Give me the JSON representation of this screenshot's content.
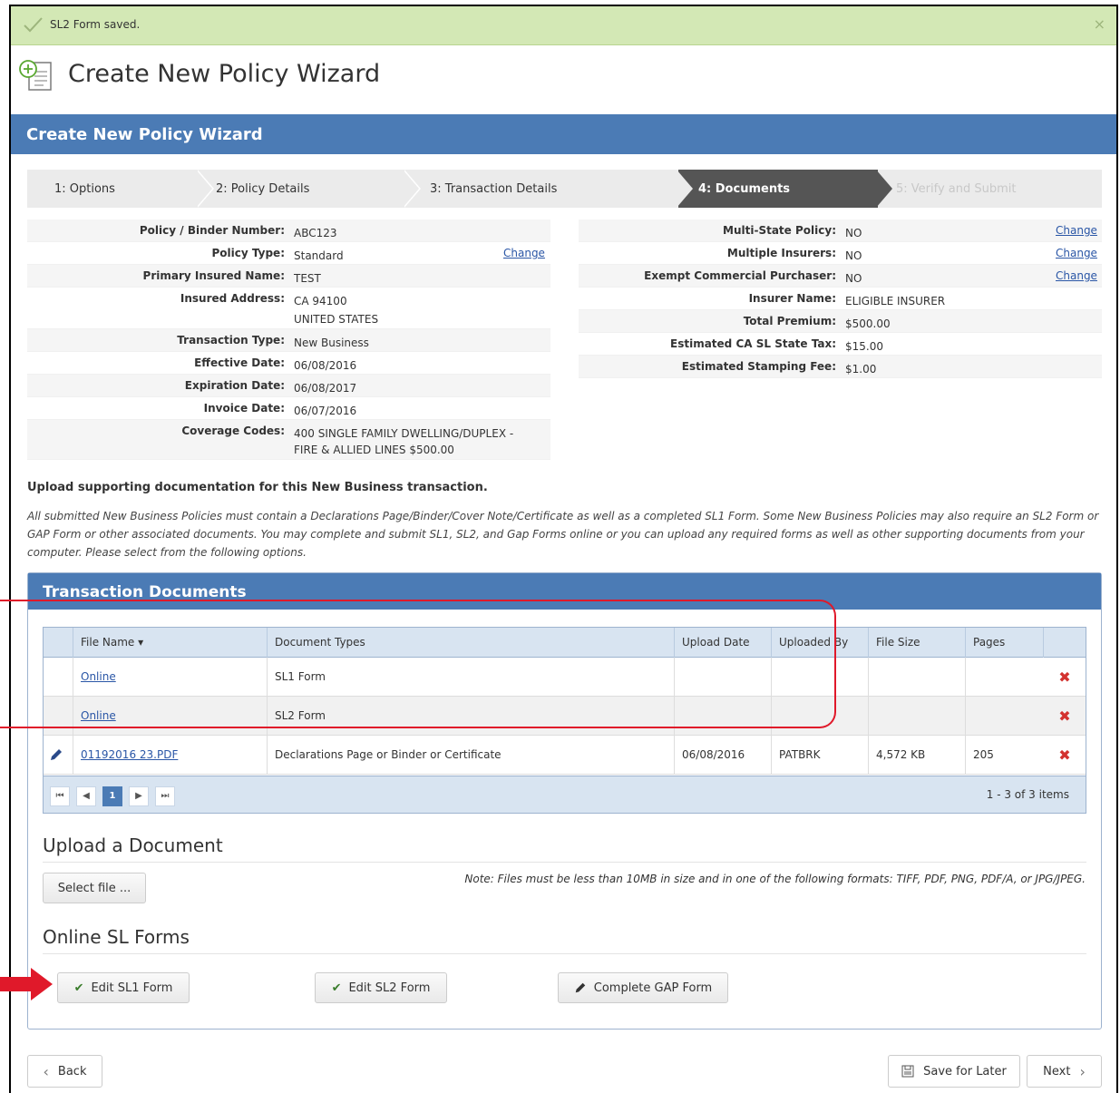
{
  "alert": {
    "message": "SL2 Form saved.",
    "close": "×"
  },
  "page": {
    "title": "Create New Policy Wizard"
  },
  "panel": {
    "title": "Create New Policy Wizard"
  },
  "steps": [
    {
      "label": "1: Options"
    },
    {
      "label": "2: Policy Details"
    },
    {
      "label": "3: Transaction Details"
    },
    {
      "label": "4: Documents"
    },
    {
      "label": "5: Verify and Submit"
    }
  ],
  "left_info": [
    {
      "label": "Policy / Binder Number:",
      "value": "ABC123"
    },
    {
      "label": "Policy Type:",
      "value": "Standard",
      "action": "Change"
    },
    {
      "label": "Primary Insured Name:",
      "value": "TEST"
    },
    {
      "label": "Insured Address:",
      "value": "CA 94100",
      "value2": "UNITED STATES"
    },
    {
      "label": "Transaction Type:",
      "value": "New Business"
    },
    {
      "label": "Effective Date:",
      "value": "06/08/2016"
    },
    {
      "label": "Expiration Date:",
      "value": "06/08/2017"
    },
    {
      "label": "Invoice Date:",
      "value": "06/07/2016"
    },
    {
      "label": "Coverage Codes:",
      "value": "400 SINGLE FAMILY DWELLING/DUPLEX -",
      "value2": "FIRE & ALLIED LINES $500.00"
    }
  ],
  "right_info": [
    {
      "label": "Multi-State Policy:",
      "value": "NO",
      "action": "Change"
    },
    {
      "label": "Multiple Insurers:",
      "value": "NO",
      "action": "Change"
    },
    {
      "label": "Exempt Commercial Purchaser:",
      "value": "NO",
      "action": "Change"
    },
    {
      "label": "Insurer Name:",
      "value": "ELIGIBLE INSURER"
    },
    {
      "label": "Total Premium:",
      "value": "$500.00"
    },
    {
      "label": "Estimated CA SL State Tax:",
      "value": "$15.00"
    },
    {
      "label": "Estimated Stamping Fee:",
      "value": "$1.00"
    }
  ],
  "upload": {
    "heading": "Upload supporting documentation for this New Business transaction.",
    "description": "All submitted New Business Policies must contain a Declarations Page/Binder/Cover Note/Certificate as well as a completed SL1 Form. Some New Business Policies may also require an SL2 Form or GAP Form or other associated documents. You may complete and submit SL1, SL2, and Gap Forms online or you can upload any required forms as well as other supporting documents from your computer. Please select from the following options."
  },
  "documents": {
    "title": "Transaction Documents",
    "columns": [
      "File Name ▾",
      "Document Types",
      "Upload Date",
      "Uploaded By",
      "File Size",
      "Pages"
    ],
    "rows": [
      {
        "file": "Online",
        "type": "SL1 Form",
        "date": "",
        "by": "",
        "size": "",
        "pages": ""
      },
      {
        "file": "Online",
        "type": "SL2 Form",
        "date": "",
        "by": "",
        "size": "",
        "pages": ""
      },
      {
        "file": "01192016 23.PDF",
        "type": "Declarations Page or Binder or Certificate",
        "date": "06/08/2016",
        "by": "PATBRK",
        "size": "4,572 KB",
        "pages": "205"
      }
    ],
    "pager": {
      "first": "⏮",
      "prev": "◀",
      "current": "1",
      "next": "▶",
      "last": "⏭",
      "info": "1 - 3 of 3 items"
    }
  },
  "upload_doc": {
    "title": "Upload a Document",
    "select_label": "Select file ...",
    "note": "Note: Files must be less than 10MB in size and in one of the following formats: TIFF, PDF, PNG, PDF/A, or JPG/JPEG."
  },
  "online_forms": {
    "title": "Online SL Forms",
    "edit_sl1": "Edit SL1 Form",
    "edit_sl2": "Edit SL2 Form",
    "complete_gap": "Complete GAP Form"
  },
  "footer": {
    "back": "Back",
    "save_later": "Save for Later",
    "next": "Next"
  },
  "colors": {
    "header_blue": "#4b7bb5",
    "alert_green": "#d3e8b5",
    "link_blue": "#2a56a6",
    "delete_red": "#d3322f",
    "highlight_red": "#e0192a"
  },
  "icons": [
    "check-icon",
    "wizard-icon",
    "pencil-icon",
    "delete-icon",
    "save-icon",
    "chevron-left-icon",
    "chevron-right-icon"
  ]
}
